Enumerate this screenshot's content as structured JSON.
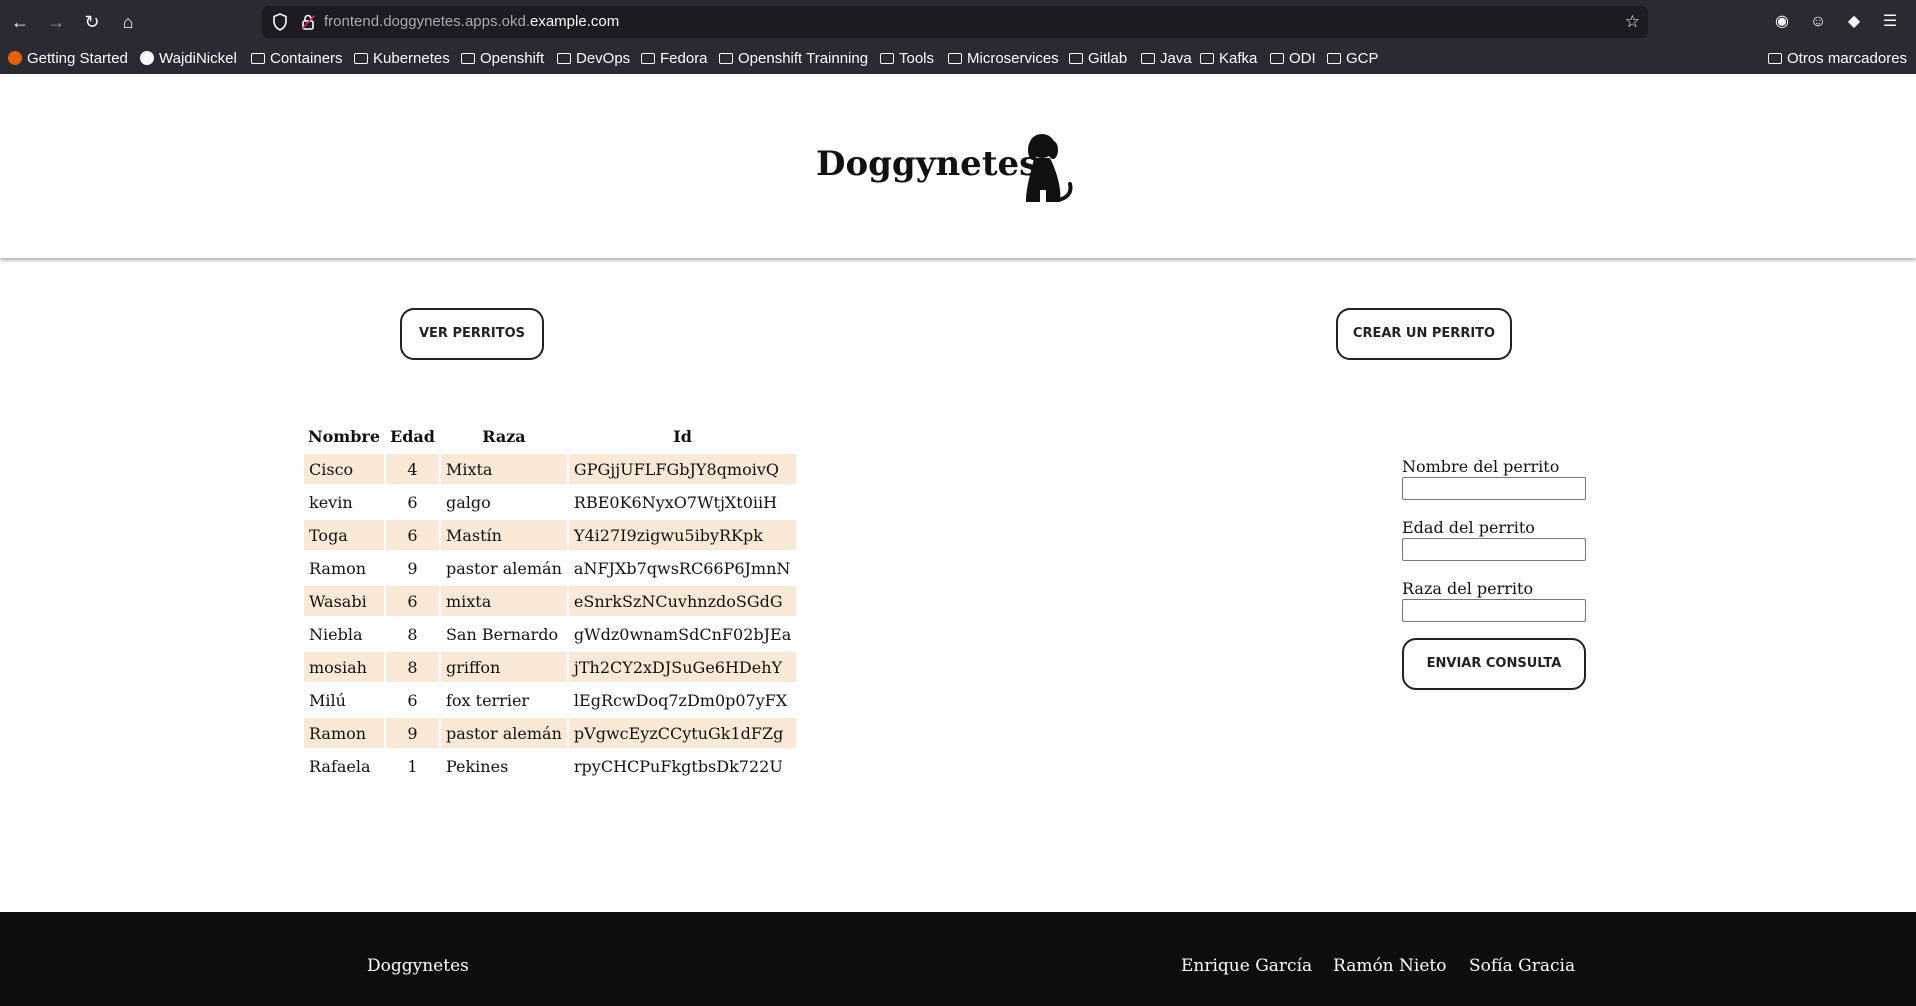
{
  "browser": {
    "url_prefix": "frontend.doggynetes.apps.okd.",
    "url_domain": "example.com",
    "bookmarks": [
      "Getting Started",
      "WajdiNickel",
      "Containers",
      "Kubernetes",
      "Openshift",
      "DevOps",
      "Fedora",
      "Openshift Trainning",
      "Tools",
      "Microservices",
      "Gitlab",
      "Java",
      "Kafka",
      "ODI",
      "GCP"
    ],
    "other_bookmarks": "Otros marcadores"
  },
  "header": {
    "title": "Doggynetes"
  },
  "actions": {
    "ver": "VER PERRITOS",
    "crear": "CREAR UN PERRITO"
  },
  "table": {
    "headers": [
      "Nombre",
      "Edad",
      "Raza",
      "Id"
    ],
    "rows": [
      [
        "Cisco",
        "4",
        "Mixta",
        "GPGjjUFLFGbJY8qmoivQ"
      ],
      [
        "kevin",
        "6",
        "galgo",
        "RBE0K6NyxO7WtjXt0iiH"
      ],
      [
        "Toga",
        "6",
        "Mastín",
        "Y4i27I9zigwu5ibyRKpk"
      ],
      [
        "Ramon",
        "9",
        "pastor alemán",
        "aNFJXb7qwsRC66P6JmnN"
      ],
      [
        "Wasabi",
        "6",
        "mixta",
        "eSnrkSzNCuvhnzdoSGdG"
      ],
      [
        "Niebla",
        "8",
        "San Bernardo",
        "gWdz0wnamSdCnF02bJEa"
      ],
      [
        "mosiah",
        "8",
        "griffon",
        "jTh2CY2xDJSuGe6HDehY"
      ],
      [
        "Milú",
        "6",
        "fox terrier",
        "lEgRcwDoq7zDm0p07yFX"
      ],
      [
        "Ramon",
        "9",
        "pastor alemán",
        "pVgwcEyzCCytuGk1dFZg"
      ],
      [
        "Rafaela",
        "1",
        "Pekines",
        "rpyCHCPuFkgtbsDk722U"
      ]
    ]
  },
  "form": {
    "nombre_label": "Nombre del perrito",
    "edad_label": "Edad del perrito",
    "raza_label": "Raza del perrito",
    "submit": "ENVIAR CONSULTA"
  },
  "footer": {
    "brand": "Doggynetes",
    "authors": [
      "Enrique García",
      "Ramón Nieto",
      "Sofía Gracia"
    ]
  }
}
